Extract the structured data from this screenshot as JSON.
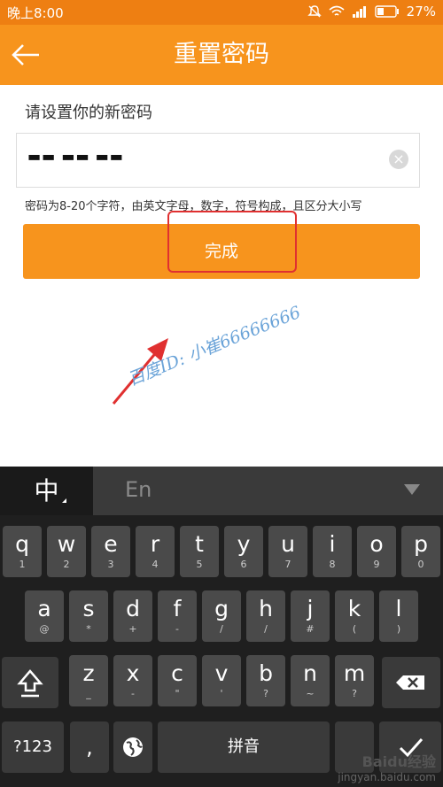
{
  "status": {
    "time": "晚上8:00",
    "battery": "27%"
  },
  "header": {
    "title": "重置密码"
  },
  "form": {
    "prompt": "请设置你的新密码",
    "password_masked": "▬▬ ▬▬ ▬▬",
    "hint": "密码为8-20个字符，由英文字母，数字，符号构成，且区分大小写",
    "submit_label": "完成"
  },
  "watermark": "百度ID: 小崔66666666",
  "keyboard": {
    "lang_zh": "中",
    "lang_en": "En",
    "row1": [
      [
        "q",
        "1"
      ],
      [
        "w",
        "2"
      ],
      [
        "e",
        "3"
      ],
      [
        "r",
        "4"
      ],
      [
        "t",
        "5"
      ],
      [
        "y",
        "6"
      ],
      [
        "u",
        "7"
      ],
      [
        "i",
        "8"
      ],
      [
        "o",
        "9"
      ],
      [
        "p",
        "0"
      ]
    ],
    "row2": [
      [
        "a",
        "@"
      ],
      [
        "s",
        "*"
      ],
      [
        "d",
        "+"
      ],
      [
        "f",
        "-"
      ],
      [
        "g",
        "/"
      ],
      [
        "h",
        "/"
      ],
      [
        "j",
        "#"
      ],
      [
        "k",
        "("
      ],
      [
        "l",
        ")"
      ]
    ],
    "row3": [
      [
        "z",
        "_"
      ],
      [
        "x",
        "-"
      ],
      [
        "c",
        "\""
      ],
      [
        "v",
        "'"
      ],
      [
        "b",
        "?"
      ],
      [
        "n",
        "~"
      ],
      [
        "m",
        "?"
      ]
    ],
    "key_123": "?123",
    "key_comma": ",",
    "key_space": "拼音",
    "footer": "Baidu经验",
    "footer_url": "jingyan.baidu.com"
  },
  "colors": {
    "accent": "#f7941d",
    "annotation": "#e03030"
  }
}
